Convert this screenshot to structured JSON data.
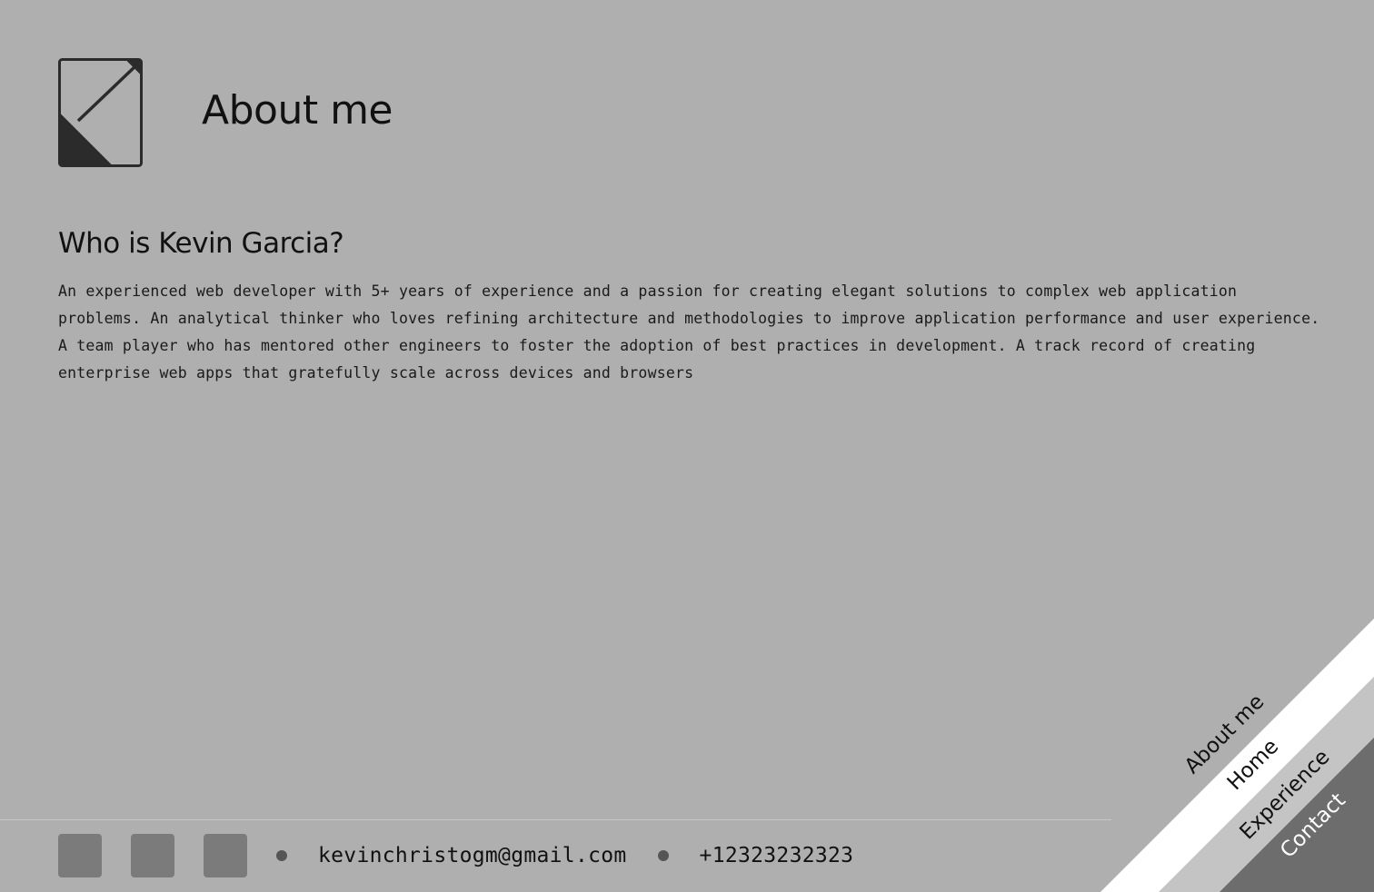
{
  "header": {
    "title": "About me"
  },
  "about": {
    "heading": "Who is Kevin Garcia?",
    "bio": "An experienced web developer with 5+ years of experience and a passion for creating elegant solutions to complex web application problems. An analytical thinker who loves refining architecture and methodologies to improve application performance and user experience. A team player who has mentored other engineers to foster the adoption of best practices in development. A track record of creating enterprise web apps that gratefully scale across devices and browsers"
  },
  "footer": {
    "social_icons": [
      "social-icon-1",
      "social-icon-2",
      "social-icon-3"
    ],
    "email": "kevinchristogm@gmail.com",
    "phone": "+12323232323"
  },
  "corner_nav": {
    "items": [
      {
        "label": "About me",
        "color": "#111111"
      },
      {
        "label": "Home",
        "color": "#111111"
      },
      {
        "label": "Experience",
        "color": "#111111"
      },
      {
        "label": "Contact",
        "color": "#ffffff"
      }
    ]
  },
  "colors": {
    "background": "#afafaf",
    "logo": "#2b2b2b",
    "social_icon": "#7b7b7b",
    "band_white": "#ffffff",
    "band_light": "#c4c4c4",
    "band_dark": "#6d6d6d"
  }
}
